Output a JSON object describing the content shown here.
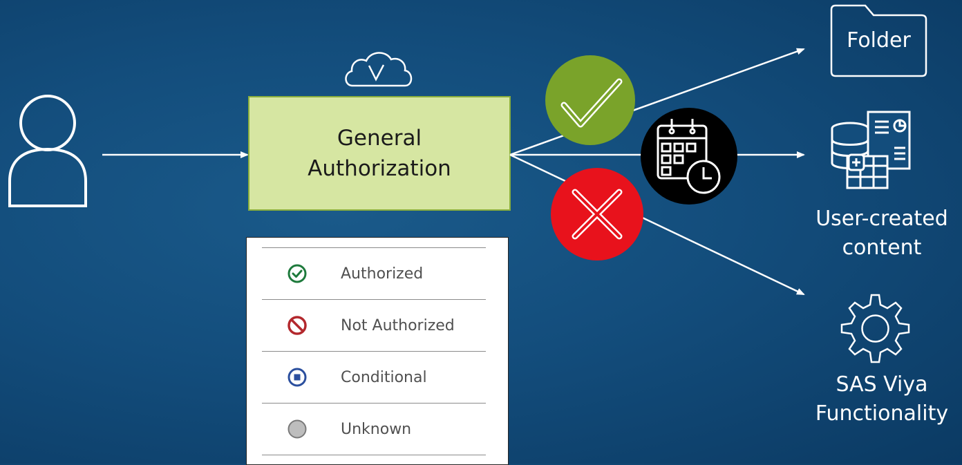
{
  "main_box": {
    "line1": "General",
    "line2": "Authorization"
  },
  "legend": {
    "items": [
      {
        "label": "Authorized",
        "icon": "check-circle-icon",
        "color": "#1e7a3c"
      },
      {
        "label": "Not Authorized",
        "icon": "prohibited-icon",
        "color": "#b3282d"
      },
      {
        "label": "Conditional",
        "icon": "conditional-square-icon",
        "color": "#2b4f9e"
      },
      {
        "label": "Unknown",
        "icon": "unknown-circle-icon",
        "color": "#bdbdbd"
      }
    ]
  },
  "destinations": {
    "folder": {
      "label": "Folder"
    },
    "content": {
      "line1": "User-created",
      "line2": "content"
    },
    "functionality": {
      "line1": "SAS Viya",
      "line2": "Functionality"
    }
  },
  "colors": {
    "background": "#134d7c",
    "box_fill": "#d6e6a2",
    "approved": "#7aa32a",
    "denied": "#e8121c",
    "conditional": "#000000"
  }
}
